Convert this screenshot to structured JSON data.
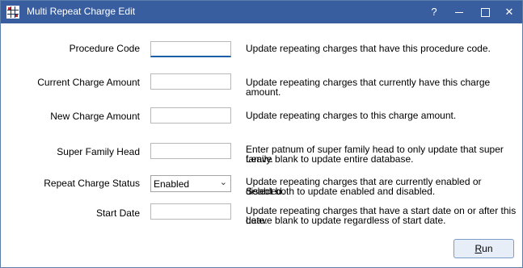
{
  "window": {
    "title": "Multi Repeat Charge Edit"
  },
  "titlebar_buttons": {
    "help": "?",
    "minimize": "",
    "maximize": "",
    "close": "✕"
  },
  "fields": [
    {
      "label": "Procedure Code",
      "value": "",
      "description_lines": [
        "Update repeating charges that have this procedure code."
      ]
    },
    {
      "label": "Current Charge Amount",
      "value": "",
      "description_lines": [
        "Update repeating charges that currently have this charge amount."
      ]
    },
    {
      "label": "New Charge Amount",
      "value": "",
      "description_lines": [
        "Update repeating charges to this charge amount."
      ]
    },
    {
      "label": "Super Family Head",
      "value": "",
      "description_lines": [
        "Enter patnum of super family head to only update that super family.",
        "Leave blank to update entire database."
      ]
    },
    {
      "label": "Repeat Charge Status",
      "value": "Enabled",
      "description_lines": [
        "Update repeating charges that are currently enabled or disabled.",
        "Select both to update enabled and disabled."
      ]
    },
    {
      "label": "Start Date",
      "value": "",
      "description_lines": [
        "Update repeating charges that have a start date on or after this date.",
        "Leave blank to update regardless of start date."
      ]
    }
  ],
  "run_button": {
    "label_prefix": "",
    "label_underlined": "R",
    "label_suffix": "un"
  }
}
